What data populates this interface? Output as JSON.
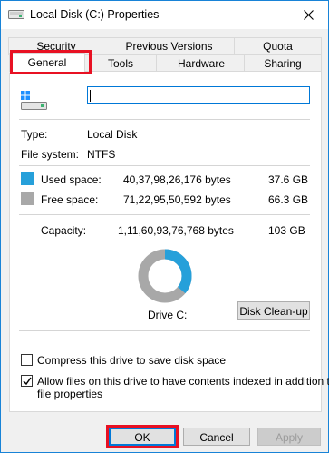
{
  "window": {
    "title": "Local Disk (C:) Properties"
  },
  "tabs_row1": [
    {
      "label": "Security"
    },
    {
      "label": "Previous Versions"
    },
    {
      "label": "Quota"
    }
  ],
  "tabs_row2": [
    {
      "label": "General",
      "active": true
    },
    {
      "label": "Tools"
    },
    {
      "label": "Hardware"
    },
    {
      "label": "Sharing"
    }
  ],
  "general": {
    "drive_name_value": "",
    "type_label": "Type:",
    "type_value": "Local Disk",
    "fs_label": "File system:",
    "fs_value": "NTFS",
    "used_label": "Used space:",
    "used_bytes": "40,37,98,26,176 bytes",
    "used_gb": "37.6 GB",
    "free_label": "Free space:",
    "free_bytes": "71,22,95,50,592 bytes",
    "free_gb": "66.3 GB",
    "capacity_label": "Capacity:",
    "capacity_bytes": "1,11,60,93,76,768 bytes",
    "capacity_gb": "103 GB",
    "drive_label": "Drive C:",
    "cleanup_button": "Disk Clean-up",
    "compress_label": "Compress this drive to save disk space",
    "compress_checked": false,
    "index_label_line1": "Allow files on this drive to have contents indexed in addition to",
    "index_label_line2": "file properties",
    "index_checked": true
  },
  "usage": {
    "used_fraction": 0.362,
    "used_color": "#26a0da",
    "free_color": "#a8a8a8"
  },
  "footer": {
    "ok": "OK",
    "cancel": "Cancel",
    "apply": "Apply"
  },
  "colors": {
    "accent": "#0078d7",
    "highlight_box": "#e81123"
  }
}
